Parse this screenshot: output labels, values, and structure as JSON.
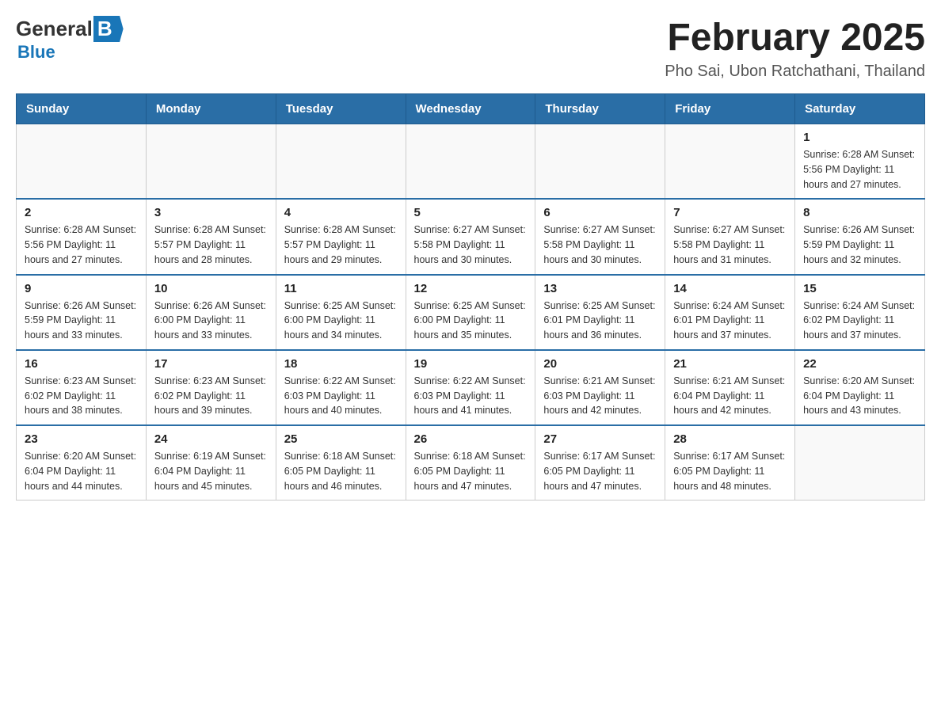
{
  "header": {
    "logo": {
      "general": "General",
      "blue": "Blue"
    },
    "title": "February 2025",
    "subtitle": "Pho Sai, Ubon Ratchathani, Thailand"
  },
  "calendar": {
    "days_of_week": [
      "Sunday",
      "Monday",
      "Tuesday",
      "Wednesday",
      "Thursday",
      "Friday",
      "Saturday"
    ],
    "weeks": [
      {
        "days": [
          {
            "number": "",
            "info": "",
            "empty": true
          },
          {
            "number": "",
            "info": "",
            "empty": true
          },
          {
            "number": "",
            "info": "",
            "empty": true
          },
          {
            "number": "",
            "info": "",
            "empty": true
          },
          {
            "number": "",
            "info": "",
            "empty": true
          },
          {
            "number": "",
            "info": "",
            "empty": true
          },
          {
            "number": "1",
            "info": "Sunrise: 6:28 AM\nSunset: 5:56 PM\nDaylight: 11 hours\nand 27 minutes."
          }
        ]
      },
      {
        "days": [
          {
            "number": "2",
            "info": "Sunrise: 6:28 AM\nSunset: 5:56 PM\nDaylight: 11 hours\nand 27 minutes."
          },
          {
            "number": "3",
            "info": "Sunrise: 6:28 AM\nSunset: 5:57 PM\nDaylight: 11 hours\nand 28 minutes."
          },
          {
            "number": "4",
            "info": "Sunrise: 6:28 AM\nSunset: 5:57 PM\nDaylight: 11 hours\nand 29 minutes."
          },
          {
            "number": "5",
            "info": "Sunrise: 6:27 AM\nSunset: 5:58 PM\nDaylight: 11 hours\nand 30 minutes."
          },
          {
            "number": "6",
            "info": "Sunrise: 6:27 AM\nSunset: 5:58 PM\nDaylight: 11 hours\nand 30 minutes."
          },
          {
            "number": "7",
            "info": "Sunrise: 6:27 AM\nSunset: 5:58 PM\nDaylight: 11 hours\nand 31 minutes."
          },
          {
            "number": "8",
            "info": "Sunrise: 6:26 AM\nSunset: 5:59 PM\nDaylight: 11 hours\nand 32 minutes."
          }
        ]
      },
      {
        "days": [
          {
            "number": "9",
            "info": "Sunrise: 6:26 AM\nSunset: 5:59 PM\nDaylight: 11 hours\nand 33 minutes."
          },
          {
            "number": "10",
            "info": "Sunrise: 6:26 AM\nSunset: 6:00 PM\nDaylight: 11 hours\nand 33 minutes."
          },
          {
            "number": "11",
            "info": "Sunrise: 6:25 AM\nSunset: 6:00 PM\nDaylight: 11 hours\nand 34 minutes."
          },
          {
            "number": "12",
            "info": "Sunrise: 6:25 AM\nSunset: 6:00 PM\nDaylight: 11 hours\nand 35 minutes."
          },
          {
            "number": "13",
            "info": "Sunrise: 6:25 AM\nSunset: 6:01 PM\nDaylight: 11 hours\nand 36 minutes."
          },
          {
            "number": "14",
            "info": "Sunrise: 6:24 AM\nSunset: 6:01 PM\nDaylight: 11 hours\nand 37 minutes."
          },
          {
            "number": "15",
            "info": "Sunrise: 6:24 AM\nSunset: 6:02 PM\nDaylight: 11 hours\nand 37 minutes."
          }
        ]
      },
      {
        "days": [
          {
            "number": "16",
            "info": "Sunrise: 6:23 AM\nSunset: 6:02 PM\nDaylight: 11 hours\nand 38 minutes."
          },
          {
            "number": "17",
            "info": "Sunrise: 6:23 AM\nSunset: 6:02 PM\nDaylight: 11 hours\nand 39 minutes."
          },
          {
            "number": "18",
            "info": "Sunrise: 6:22 AM\nSunset: 6:03 PM\nDaylight: 11 hours\nand 40 minutes."
          },
          {
            "number": "19",
            "info": "Sunrise: 6:22 AM\nSunset: 6:03 PM\nDaylight: 11 hours\nand 41 minutes."
          },
          {
            "number": "20",
            "info": "Sunrise: 6:21 AM\nSunset: 6:03 PM\nDaylight: 11 hours\nand 42 minutes."
          },
          {
            "number": "21",
            "info": "Sunrise: 6:21 AM\nSunset: 6:04 PM\nDaylight: 11 hours\nand 42 minutes."
          },
          {
            "number": "22",
            "info": "Sunrise: 6:20 AM\nSunset: 6:04 PM\nDaylight: 11 hours\nand 43 minutes."
          }
        ]
      },
      {
        "days": [
          {
            "number": "23",
            "info": "Sunrise: 6:20 AM\nSunset: 6:04 PM\nDaylight: 11 hours\nand 44 minutes."
          },
          {
            "number": "24",
            "info": "Sunrise: 6:19 AM\nSunset: 6:04 PM\nDaylight: 11 hours\nand 45 minutes."
          },
          {
            "number": "25",
            "info": "Sunrise: 6:18 AM\nSunset: 6:05 PM\nDaylight: 11 hours\nand 46 minutes."
          },
          {
            "number": "26",
            "info": "Sunrise: 6:18 AM\nSunset: 6:05 PM\nDaylight: 11 hours\nand 47 minutes."
          },
          {
            "number": "27",
            "info": "Sunrise: 6:17 AM\nSunset: 6:05 PM\nDaylight: 11 hours\nand 47 minutes."
          },
          {
            "number": "28",
            "info": "Sunrise: 6:17 AM\nSunset: 6:05 PM\nDaylight: 11 hours\nand 48 minutes."
          },
          {
            "number": "",
            "info": "",
            "empty": true
          }
        ]
      }
    ]
  }
}
